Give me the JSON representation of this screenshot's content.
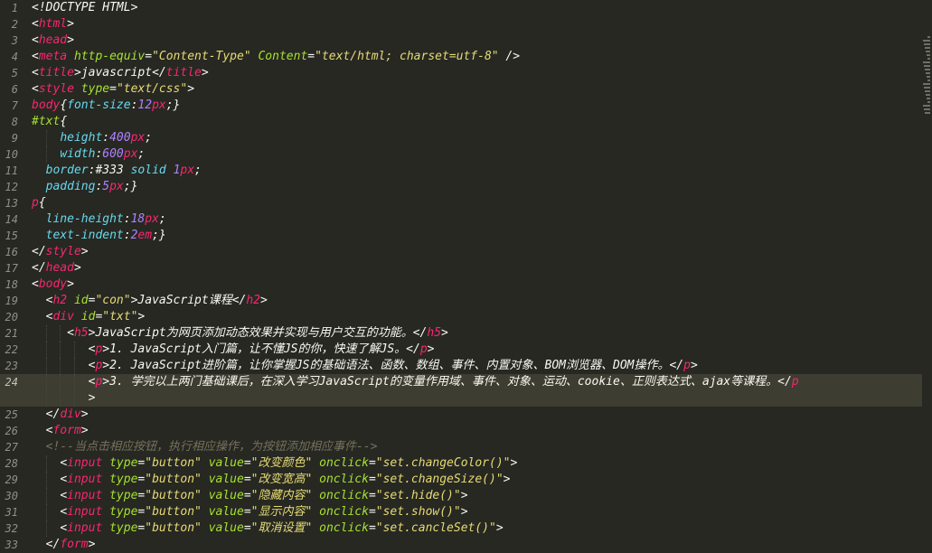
{
  "editor": {
    "current_line": 24,
    "colors": {
      "background": "#272822",
      "tag": "#f92672",
      "attribute": "#a6e22e",
      "string": "#e6db74",
      "number": "#ae81ff",
      "property": "#66d9ef",
      "text": "#f8f8f2",
      "comment": "#75715e"
    },
    "lines": [
      {
        "n": "1",
        "tokens": [
          [
            "punct",
            "<!DOCTYPE HTML>"
          ]
        ]
      },
      {
        "n": "2",
        "tokens": [
          [
            "punct",
            "<"
          ],
          [
            "tag",
            "html"
          ],
          [
            "punct",
            ">"
          ]
        ]
      },
      {
        "n": "3",
        "tokens": [
          [
            "punct",
            "<"
          ],
          [
            "tag",
            "head"
          ],
          [
            "punct",
            ">"
          ]
        ]
      },
      {
        "n": "4",
        "tokens": [
          [
            "punct",
            "<"
          ],
          [
            "tag",
            "meta"
          ],
          [
            "text",
            " "
          ],
          [
            "attr",
            "http-equiv"
          ],
          [
            "punct",
            "="
          ],
          [
            "str",
            "\"Content-Type\""
          ],
          [
            "text",
            " "
          ],
          [
            "attr",
            "Content"
          ],
          [
            "punct",
            "="
          ],
          [
            "str",
            "\"text/html; charset=utf-8\""
          ],
          [
            "punct",
            " />"
          ]
        ]
      },
      {
        "n": "5",
        "tokens": [
          [
            "punct",
            "<"
          ],
          [
            "tag",
            "title"
          ],
          [
            "punct",
            ">"
          ],
          [
            "text",
            "javascript"
          ],
          [
            "punct",
            "</"
          ],
          [
            "tag",
            "title"
          ],
          [
            "punct",
            ">"
          ]
        ]
      },
      {
        "n": "6",
        "tokens": [
          [
            "punct",
            "<"
          ],
          [
            "tag",
            "style"
          ],
          [
            "text",
            " "
          ],
          [
            "attr",
            "type"
          ],
          [
            "punct",
            "="
          ],
          [
            "str",
            "\"text/css\""
          ],
          [
            "punct",
            ">"
          ]
        ]
      },
      {
        "n": "7",
        "tokens": [
          [
            "tag",
            "body"
          ],
          [
            "punct",
            "{"
          ],
          [
            "prop",
            "font-size"
          ],
          [
            "punct",
            ":"
          ],
          [
            "num",
            "12"
          ],
          [
            "tag",
            "px"
          ],
          [
            "punct",
            ";}"
          ]
        ]
      },
      {
        "n": "8",
        "tokens": [
          [
            "attr",
            "#txt"
          ],
          [
            "punct",
            "{"
          ]
        ]
      },
      {
        "n": "9",
        "tokens": [
          [
            "text",
            "    "
          ],
          [
            "prop",
            "height"
          ],
          [
            "punct",
            ":"
          ],
          [
            "num",
            "400"
          ],
          [
            "tag",
            "px"
          ],
          [
            "punct",
            ";"
          ]
        ]
      },
      {
        "n": "10",
        "tokens": [
          [
            "text",
            "    "
          ],
          [
            "prop",
            "width"
          ],
          [
            "punct",
            ":"
          ],
          [
            "num",
            "600"
          ],
          [
            "tag",
            "px"
          ],
          [
            "punct",
            ";"
          ]
        ]
      },
      {
        "n": "11",
        "tokens": [
          [
            "text",
            "  "
          ],
          [
            "prop",
            "border"
          ],
          [
            "punct",
            ":"
          ],
          [
            "text",
            "#333 "
          ],
          [
            "prop",
            "solid"
          ],
          [
            "text",
            " "
          ],
          [
            "num",
            "1"
          ],
          [
            "tag",
            "px"
          ],
          [
            "punct",
            ";"
          ]
        ]
      },
      {
        "n": "12",
        "tokens": [
          [
            "text",
            "  "
          ],
          [
            "prop",
            "padding"
          ],
          [
            "punct",
            ":"
          ],
          [
            "num",
            "5"
          ],
          [
            "tag",
            "px"
          ],
          [
            "punct",
            ";}"
          ]
        ]
      },
      {
        "n": "13",
        "tokens": [
          [
            "tag",
            "p"
          ],
          [
            "punct",
            "{"
          ]
        ]
      },
      {
        "n": "14",
        "tokens": [
          [
            "text",
            "  "
          ],
          [
            "prop",
            "line-height"
          ],
          [
            "punct",
            ":"
          ],
          [
            "num",
            "18"
          ],
          [
            "tag",
            "px"
          ],
          [
            "punct",
            ";"
          ]
        ]
      },
      {
        "n": "15",
        "tokens": [
          [
            "text",
            "  "
          ],
          [
            "prop",
            "text-indent"
          ],
          [
            "punct",
            ":"
          ],
          [
            "num",
            "2"
          ],
          [
            "tag",
            "em"
          ],
          [
            "punct",
            ";}"
          ]
        ]
      },
      {
        "n": "16",
        "tokens": [
          [
            "punct",
            "</"
          ],
          [
            "tag",
            "style"
          ],
          [
            "punct",
            ">"
          ]
        ]
      },
      {
        "n": "17",
        "tokens": [
          [
            "punct",
            "</"
          ],
          [
            "tag",
            "head"
          ],
          [
            "punct",
            ">"
          ]
        ]
      },
      {
        "n": "18",
        "tokens": [
          [
            "punct",
            "<"
          ],
          [
            "tag",
            "body"
          ],
          [
            "punct",
            ">"
          ]
        ]
      },
      {
        "n": "19",
        "tokens": [
          [
            "text",
            "  "
          ],
          [
            "punct",
            "<"
          ],
          [
            "tag",
            "h2"
          ],
          [
            "text",
            " "
          ],
          [
            "attr",
            "id"
          ],
          [
            "punct",
            "="
          ],
          [
            "str",
            "\"con\""
          ],
          [
            "punct",
            ">"
          ],
          [
            "text",
            "JavaScript课程"
          ],
          [
            "punct",
            "</"
          ],
          [
            "tag",
            "h2"
          ],
          [
            "punct",
            ">"
          ]
        ]
      },
      {
        "n": "20",
        "tokens": [
          [
            "text",
            "  "
          ],
          [
            "punct",
            "<"
          ],
          [
            "tag",
            "div"
          ],
          [
            "text",
            " "
          ],
          [
            "attr",
            "id"
          ],
          [
            "punct",
            "="
          ],
          [
            "str",
            "\"txt\""
          ],
          [
            "punct",
            ">"
          ]
        ]
      },
      {
        "n": "21",
        "tokens": [
          [
            "text",
            "     "
          ],
          [
            "punct",
            "<"
          ],
          [
            "tag",
            "h5"
          ],
          [
            "punct",
            ">"
          ],
          [
            "text",
            "JavaScript为网页添加动态效果并实现与用户交互的功能。"
          ],
          [
            "punct",
            "</"
          ],
          [
            "tag",
            "h5"
          ],
          [
            "punct",
            ">"
          ]
        ]
      },
      {
        "n": "22",
        "tokens": [
          [
            "text",
            "        "
          ],
          [
            "punct",
            "<"
          ],
          [
            "tag",
            "p"
          ],
          [
            "punct",
            ">"
          ],
          [
            "text",
            "1. JavaScript入门篇，让不懂JS的你，快速了解JS。"
          ],
          [
            "punct",
            "</"
          ],
          [
            "tag",
            "p"
          ],
          [
            "punct",
            ">"
          ]
        ]
      },
      {
        "n": "23",
        "tokens": [
          [
            "text",
            "        "
          ],
          [
            "punct",
            "<"
          ],
          [
            "tag",
            "p"
          ],
          [
            "punct",
            ">"
          ],
          [
            "text",
            "2. JavaScript进阶篇，让你掌握JS的基础语法、函数、数组、事件、内置对象、BOM浏览器、DOM操作。"
          ],
          [
            "punct",
            "</"
          ],
          [
            "tag",
            "p"
          ],
          [
            "punct",
            ">"
          ]
        ]
      },
      {
        "n": "24",
        "tokens": [
          [
            "text",
            "        "
          ],
          [
            "punct",
            "<"
          ],
          [
            "tag",
            "p"
          ],
          [
            "punct",
            ">"
          ],
          [
            "text",
            "3. 学完以上两门基础课后，在深入学习JavaScript的变量作用域、事件、对象、运动、cookie、正则表达式、ajax等课程。"
          ],
          [
            "punct",
            "</"
          ],
          [
            "tag",
            "p"
          ]
        ]
      },
      {
        "n": "",
        "tokens": [
          [
            "text",
            "        "
          ],
          [
            "punct",
            ">"
          ]
        ]
      },
      {
        "n": "25",
        "tokens": [
          [
            "text",
            "  "
          ],
          [
            "punct",
            "</"
          ],
          [
            "tag",
            "div"
          ],
          [
            "punct",
            ">"
          ]
        ]
      },
      {
        "n": "26",
        "tokens": [
          [
            "text",
            "  "
          ],
          [
            "punct",
            "<"
          ],
          [
            "tag",
            "form"
          ],
          [
            "punct",
            ">"
          ]
        ]
      },
      {
        "n": "27",
        "tokens": [
          [
            "text",
            "  "
          ],
          [
            "comment",
            "<!--当点击相应按钮，执行相应操作，为按钮添加相应事件-->"
          ]
        ]
      },
      {
        "n": "28",
        "tokens": [
          [
            "text",
            "    "
          ],
          [
            "punct",
            "<"
          ],
          [
            "tag",
            "input"
          ],
          [
            "text",
            " "
          ],
          [
            "attr",
            "type"
          ],
          [
            "punct",
            "="
          ],
          [
            "str",
            "\"button\""
          ],
          [
            "text",
            " "
          ],
          [
            "attr",
            "value"
          ],
          [
            "punct",
            "="
          ],
          [
            "str",
            "\"改变颜色\""
          ],
          [
            "text",
            " "
          ],
          [
            "attr",
            "onclick"
          ],
          [
            "punct",
            "="
          ],
          [
            "str",
            "\"set.changeColor()\""
          ],
          [
            "punct",
            ">"
          ]
        ]
      },
      {
        "n": "29",
        "tokens": [
          [
            "text",
            "    "
          ],
          [
            "punct",
            "<"
          ],
          [
            "tag",
            "input"
          ],
          [
            "text",
            " "
          ],
          [
            "attr",
            "type"
          ],
          [
            "punct",
            "="
          ],
          [
            "str",
            "\"button\""
          ],
          [
            "text",
            " "
          ],
          [
            "attr",
            "value"
          ],
          [
            "punct",
            "="
          ],
          [
            "str",
            "\"改变宽高\""
          ],
          [
            "text",
            " "
          ],
          [
            "attr",
            "onclick"
          ],
          [
            "punct",
            "="
          ],
          [
            "str",
            "\"set.changeSize()\""
          ],
          [
            "punct",
            ">"
          ]
        ]
      },
      {
        "n": "30",
        "tokens": [
          [
            "text",
            "    "
          ],
          [
            "punct",
            "<"
          ],
          [
            "tag",
            "input"
          ],
          [
            "text",
            " "
          ],
          [
            "attr",
            "type"
          ],
          [
            "punct",
            "="
          ],
          [
            "str",
            "\"button\""
          ],
          [
            "text",
            " "
          ],
          [
            "attr",
            "value"
          ],
          [
            "punct",
            "="
          ],
          [
            "str",
            "\"隐藏内容\""
          ],
          [
            "text",
            " "
          ],
          [
            "attr",
            "onclick"
          ],
          [
            "punct",
            "="
          ],
          [
            "str",
            "\"set.hide()\""
          ],
          [
            "punct",
            ">"
          ]
        ]
      },
      {
        "n": "31",
        "tokens": [
          [
            "text",
            "    "
          ],
          [
            "punct",
            "<"
          ],
          [
            "tag",
            "input"
          ],
          [
            "text",
            " "
          ],
          [
            "attr",
            "type"
          ],
          [
            "punct",
            "="
          ],
          [
            "str",
            "\"button\""
          ],
          [
            "text",
            " "
          ],
          [
            "attr",
            "value"
          ],
          [
            "punct",
            "="
          ],
          [
            "str",
            "\"显示内容\""
          ],
          [
            "text",
            " "
          ],
          [
            "attr",
            "onclick"
          ],
          [
            "punct",
            "="
          ],
          [
            "str",
            "\"set.show()\""
          ],
          [
            "punct",
            ">"
          ]
        ]
      },
      {
        "n": "32",
        "tokens": [
          [
            "text",
            "    "
          ],
          [
            "punct",
            "<"
          ],
          [
            "tag",
            "input"
          ],
          [
            "text",
            " "
          ],
          [
            "attr",
            "type"
          ],
          [
            "punct",
            "="
          ],
          [
            "str",
            "\"button\""
          ],
          [
            "text",
            " "
          ],
          [
            "attr",
            "value"
          ],
          [
            "punct",
            "="
          ],
          [
            "str",
            "\"取消设置\""
          ],
          [
            "text",
            " "
          ],
          [
            "attr",
            "onclick"
          ],
          [
            "punct",
            "="
          ],
          [
            "str",
            "\"set.cancleSet()\""
          ],
          [
            "punct",
            ">"
          ]
        ]
      },
      {
        "n": "33",
        "tokens": [
          [
            "text",
            "  "
          ],
          [
            "punct",
            "</"
          ],
          [
            "tag",
            "form"
          ],
          [
            "punct",
            ">"
          ]
        ]
      }
    ]
  }
}
